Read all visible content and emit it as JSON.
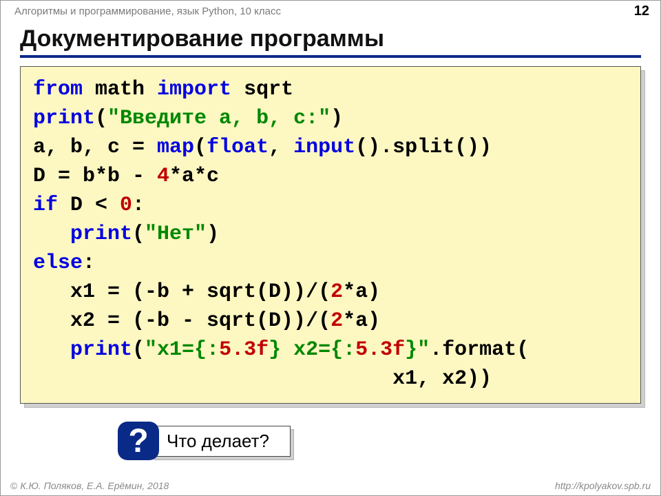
{
  "header": {
    "course": "Алгоритмы и программирование, язык Python, 10 класс",
    "page": "12"
  },
  "title": "Документирование программы",
  "code": {
    "l1": {
      "a": "from",
      "b": " math ",
      "c": "import",
      "d": " sqrt"
    },
    "l2": {
      "a": "print",
      "b": "(",
      "c": "\"Введите a, b, c:\"",
      "d": ")"
    },
    "l3": {
      "a": "a, b, c = ",
      "b": "map",
      "c": "(",
      "d": "float",
      "e": ", ",
      "f": "input",
      "g": "().split())"
    },
    "l4": {
      "a": "D = b*b - ",
      "b": "4",
      "c": "*a*c"
    },
    "l5": {
      "a": "if",
      "b": " D < ",
      "c": "0",
      "d": ":"
    },
    "l6": {
      "a": "   ",
      "b": "print",
      "c": "(",
      "d": "\"Нет\"",
      "e": ")"
    },
    "l7": {
      "a": "else",
      "b": ":"
    },
    "l8": {
      "a": "   x1 = (-b + sqrt(D))/(",
      "b": "2",
      "c": "*a)"
    },
    "l9": {
      "a": "   x2 = (-b - sqrt(D))/(",
      "b": "2",
      "c": "*a)"
    },
    "l10": {
      "a": "   ",
      "b": "print",
      "c": "(",
      "d": "\"x1={:",
      "e": "5.3f",
      "f": "} x2={:",
      "g": "5.3f",
      "h": "}\"",
      "i": ".format("
    },
    "l11": {
      "a": "                             x1, x2))"
    }
  },
  "question": {
    "mark": "?",
    "text": "Что делает?"
  },
  "footer": {
    "copy": "©",
    "left": "К.Ю. Поляков, Е.А. Ерёмин, 2018",
    "right": "http://kpolyakov.spb.ru"
  }
}
